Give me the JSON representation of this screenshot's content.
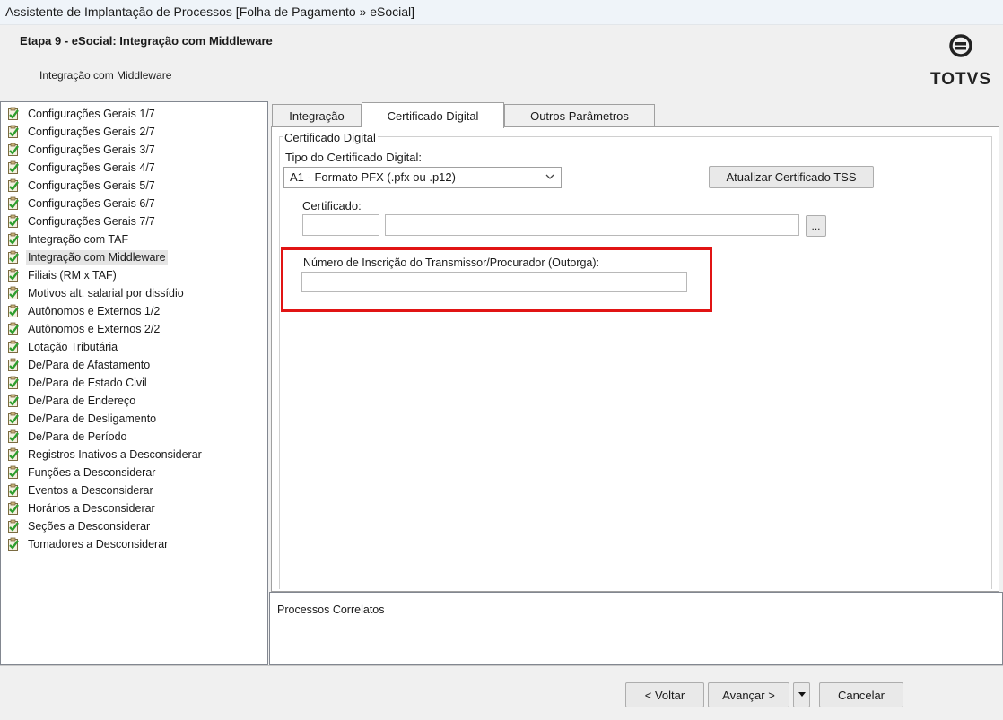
{
  "window": {
    "title": "Assistente de Implantação de Processos [Folha de Pagamento » eSocial]"
  },
  "header": {
    "step_title": "Etapa 9 - eSocial: Integração com Middleware",
    "subtitle": "Integração com Middleware",
    "logo_text": "TOTVS"
  },
  "tree": {
    "items": [
      {
        "label": "Configurações Gerais 1/7"
      },
      {
        "label": "Configurações Gerais 2/7"
      },
      {
        "label": "Configurações Gerais 3/7"
      },
      {
        "label": "Configurações Gerais 4/7"
      },
      {
        "label": "Configurações Gerais 5/7"
      },
      {
        "label": "Configurações Gerais 6/7"
      },
      {
        "label": "Configurações Gerais 7/7"
      },
      {
        "label": "Integração com TAF"
      },
      {
        "label": "Integração com Middleware"
      },
      {
        "label": "Filiais (RM x TAF)"
      },
      {
        "label": "Motivos alt. salarial por dissídio"
      },
      {
        "label": "Autônomos e Externos 1/2"
      },
      {
        "label": "Autônomos e Externos 2/2"
      },
      {
        "label": "Lotação Tributária"
      },
      {
        "label": "De/Para de Afastamento"
      },
      {
        "label": "De/Para de Estado Civil"
      },
      {
        "label": "De/Para de Endereço"
      },
      {
        "label": "De/Para de Desligamento"
      },
      {
        "label": "De/Para de Período"
      },
      {
        "label": "Registros Inativos a Desconsiderar"
      },
      {
        "label": "Funções a Desconsiderar"
      },
      {
        "label": "Eventos a Desconsiderar"
      },
      {
        "label": "Horários a Desconsiderar"
      },
      {
        "label": "Seções a Desconsiderar"
      },
      {
        "label": "Tomadores a Desconsiderar"
      }
    ],
    "selected_label": "Integração com Middleware",
    "item_icon": "checked-document-icon"
  },
  "tabs": [
    {
      "label": "Integração"
    },
    {
      "label": "Certificado Digital"
    },
    {
      "label": "Outros Parâmetros"
    }
  ],
  "active_tab": "Certificado Digital",
  "certificado": {
    "group_title": "Certificado Digital",
    "tipo_label": "Tipo do Certificado Digital:",
    "tipo_value": "A1 - Formato PFX (.pfx ou .p12)",
    "atualizar_button": "Atualizar Certificado TSS",
    "certificado_label": "Certificado:",
    "certificado_code": "",
    "certificado_desc": "",
    "browse_button": "...",
    "numero_label": "Número de Inscrição do Transmissor/Procurador (Outorga):",
    "numero_value": ""
  },
  "correlatos": {
    "title": "Processos Correlatos"
  },
  "footer": {
    "back": "< Voltar",
    "next": "Avançar >",
    "cancel": "Cancelar"
  },
  "colors": {
    "highlight": "#e11414",
    "check_green": "#2e9e2e"
  }
}
